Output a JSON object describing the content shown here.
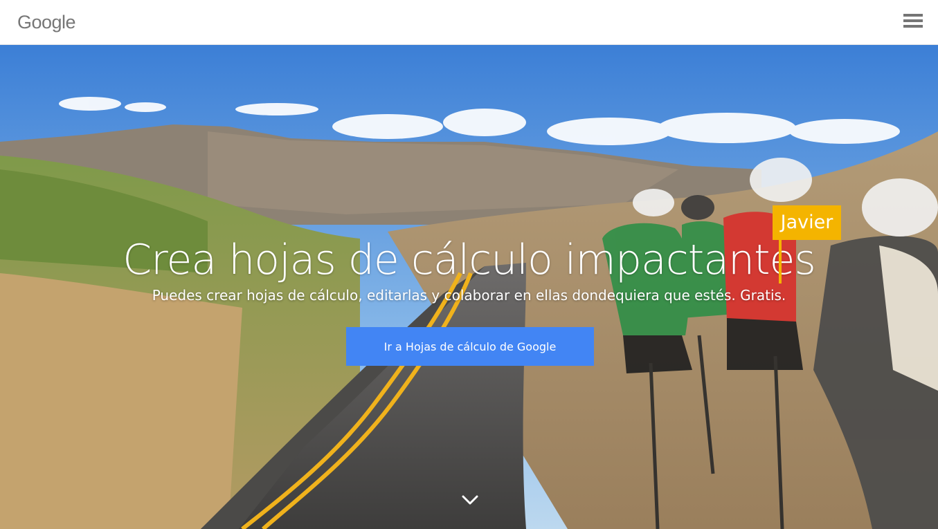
{
  "header": {
    "logo_text": "Google",
    "menu_icon": "hamburger-menu-icon"
  },
  "hero": {
    "headline": "Crea hojas de cálculo impactantes",
    "collaborator_name": "Javier",
    "subheadline": "Puedes crear hojas de cálculo, editarlas y colaborar en ellas dondequiera que estés. Gratis.",
    "cta_label": "Ir a Hojas de cálculo de Google",
    "scroll_icon": "chevron-down-icon"
  },
  "colors": {
    "accent_blue": "#4285f4",
    "cursor_yellow": "#f4b400",
    "logo_gray": "#767676"
  }
}
